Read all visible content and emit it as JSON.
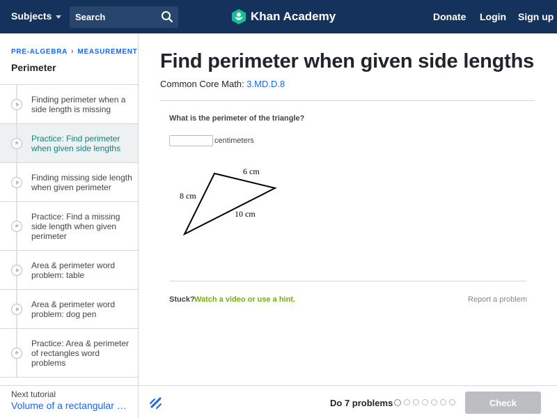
{
  "header": {
    "subjects_label": "Subjects",
    "search_placeholder": "Search",
    "logo_text": "Khan Academy",
    "donate_label": "Donate",
    "login_label": "Login",
    "signup_label": "Sign up"
  },
  "sidebar": {
    "breadcrumb": [
      "PRE-ALGEBRA",
      "MEASUREMENT"
    ],
    "breadcrumb_separator": "›",
    "title": "Perimeter",
    "items": [
      {
        "label": "Finding perimeter when a side length is missing",
        "kind": "video",
        "active": false
      },
      {
        "label": "Practice: Find perimeter when given side lengths",
        "kind": "practice",
        "active": true
      },
      {
        "label": "Finding missing side length when given perimeter",
        "kind": "video",
        "active": false
      },
      {
        "label": "Practice: Find a missing side length when given perimeter",
        "kind": "practice",
        "active": false
      },
      {
        "label": "Area & perimeter word problem: table",
        "kind": "video",
        "active": false
      },
      {
        "label": "Area & perimeter word problem: dog pen",
        "kind": "video",
        "active": false
      },
      {
        "label": "Practice: Area & perimeter of rectangles word problems",
        "kind": "practice",
        "active": false
      }
    ],
    "next_label": "Next tutorial",
    "next_link": "Volume of a rectangular prism"
  },
  "main": {
    "title": "Find perimeter when given side lengths",
    "common_core_label": "Common Core Math:",
    "common_core_code": "3.MD.D.8",
    "question": "What is the perimeter of the triangle?",
    "answer_value": "",
    "unit": "centimeters",
    "triangle_labels": {
      "top": "6 cm",
      "left": "8 cm",
      "bottom": "10 cm"
    },
    "stuck_label": "Stuck?",
    "hint_link": "Watch a video or use a hint.",
    "report_link": "Report a problem"
  },
  "footer": {
    "do_label": "Do 7 problems",
    "problem_count": 7,
    "check_label": "Check"
  },
  "colors": {
    "header_bg": "#14325c",
    "link_blue": "#1865f2",
    "active_teal": "#11817f",
    "hint_green": "#71b307",
    "check_disabled": "#bcbec2"
  }
}
